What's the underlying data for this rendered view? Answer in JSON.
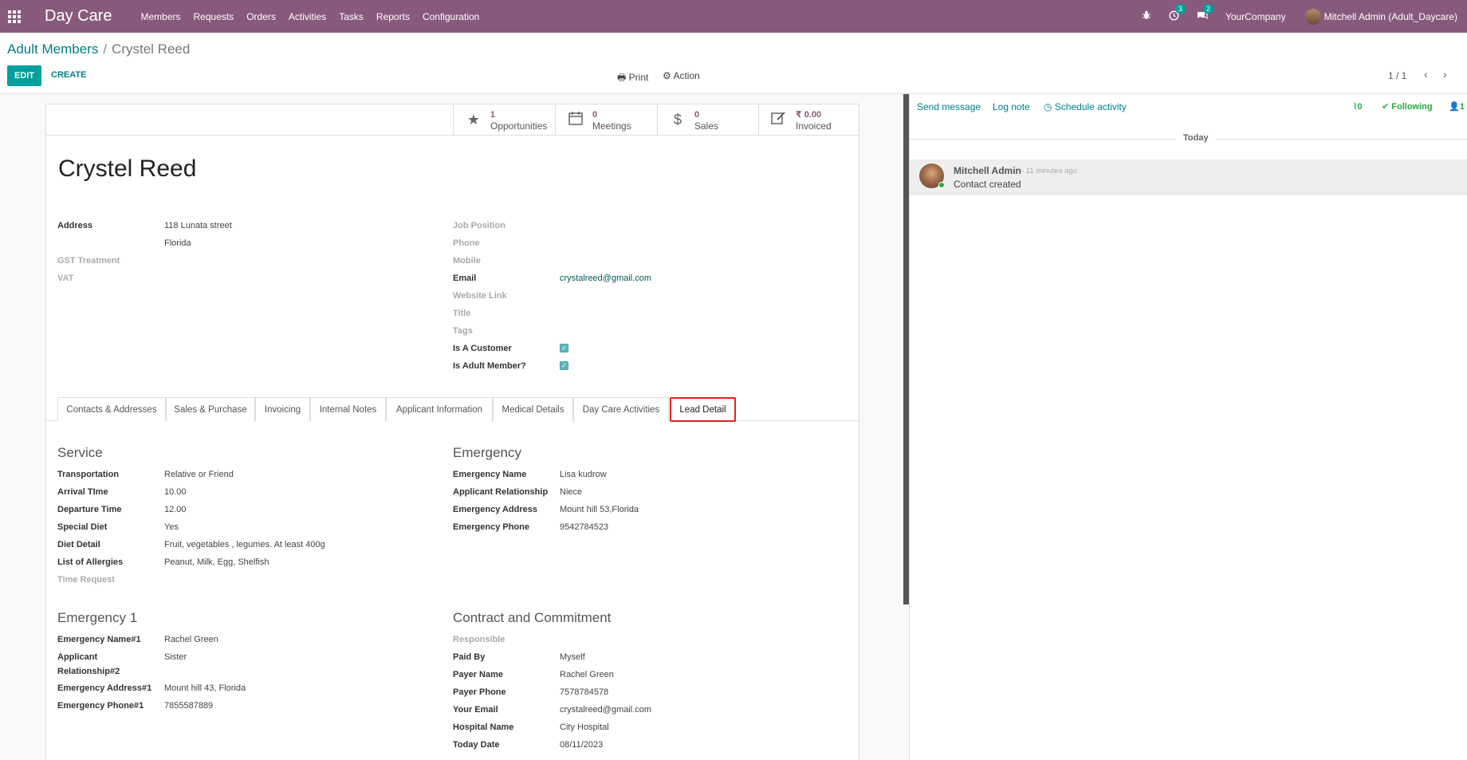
{
  "navbar": {
    "brand": "Day Care",
    "menu": [
      "Members",
      "Requests",
      "Orders",
      "Activities",
      "Tasks",
      "Reports",
      "Configuration"
    ],
    "activity_count": "3",
    "message_count": "2",
    "company": "YourCompany",
    "user": "Mitchell Admin (Adult_Daycare)"
  },
  "control": {
    "breadcrumb_parent": "Adult Members",
    "breadcrumb_sep": "/",
    "breadcrumb_current": "Crystel Reed",
    "edit_label": "EDIT",
    "create_label": "CREATE",
    "print_label": "Print",
    "action_label": "Action",
    "pager": "1 / 1"
  },
  "stats": [
    {
      "value": "1",
      "label": "Opportunities",
      "icon": "star-icon"
    },
    {
      "value": "0",
      "label": "Meetings",
      "icon": "calendar-icon"
    },
    {
      "value": "0",
      "label": "Sales",
      "icon": "dollar-icon"
    },
    {
      "value": "₹ 0.00",
      "label": "Invoiced",
      "icon": "edit-icon"
    }
  ],
  "partner": {
    "name": "Crystel Reed",
    "address_label": "Address",
    "street": "118 Lunata street",
    "state": "Florida",
    "gst_label": "GST Treatment",
    "vat_label": "VAT",
    "job_label": "Job Position",
    "phone_label": "Phone",
    "mobile_label": "Mobile",
    "email_label": "Email",
    "email": "crystalreed@gmail.com",
    "website_label": "Website Link",
    "title_label": "Title",
    "tags_label": "Tags",
    "customer_label": "Is A Customer",
    "adult_label": "Is Adult Member?"
  },
  "tabs": [
    "Contacts & Addresses",
    "Sales & Purchase",
    "Invoicing",
    "Internal Notes",
    "Applicant Information",
    "Medical Details",
    "Day Care Activities",
    "Lead Detail"
  ],
  "service": {
    "title": "Service",
    "rows": [
      {
        "label": "Transportation",
        "value": "Relative or Friend"
      },
      {
        "label": "Arrival TIme",
        "value": "10.00"
      },
      {
        "label": "Departure Time",
        "value": "12.00"
      },
      {
        "label": "Special Diet",
        "value": "Yes"
      },
      {
        "label": "Diet Detail",
        "value": "Fruit, vegetables , legumes. At least 400g"
      },
      {
        "label": "List of Allergies",
        "value": "Peanut, Milk, Egg, Shelfish"
      },
      {
        "label": "Time Request",
        "value": ""
      }
    ]
  },
  "emergency": {
    "title": "Emergency",
    "rows": [
      {
        "label": "Emergency Name",
        "value": "Lisa kudrow"
      },
      {
        "label": "Applicant Relationship",
        "value": "Niece"
      },
      {
        "label": "Emergency Address",
        "value": "Mount hill 53,Florida"
      },
      {
        "label": "Emergency Phone",
        "value": "9542784523"
      }
    ]
  },
  "emergency1": {
    "title": "Emergency 1",
    "rows": [
      {
        "label": "Emergency Name#1",
        "value": "Rachel Green"
      },
      {
        "label": "Applicant",
        "label2": "Relationship#2",
        "value": "Sister"
      },
      {
        "label": "Emergency Address#1",
        "value": "Mount hill 43, Florida"
      },
      {
        "label": "Emergency Phone#1",
        "value": "7855587889"
      }
    ]
  },
  "contract": {
    "title": "Contract and Commitment",
    "rows": [
      {
        "label": "Responsible",
        "value": ""
      },
      {
        "label": "Paid By",
        "value": "Myself"
      },
      {
        "label": "Payer Name",
        "value": "Rachel Green"
      },
      {
        "label": "Payer Phone",
        "value": "7578784578"
      },
      {
        "label": "Your Email",
        "value": "crystalreed@gmail.com"
      },
      {
        "label": "Hospital Name",
        "value": "City Hospital"
      },
      {
        "label": "Today Date",
        "value": "08/11/2023"
      }
    ]
  },
  "chatter": {
    "send_message": "Send message",
    "log_note": "Log note",
    "schedule_activity": "Schedule activity",
    "attachments": "0",
    "following": "Following",
    "followers": "1",
    "today": "Today",
    "author": "Mitchell Admin",
    "time": "- 11 minutes ago",
    "body": "Contact created"
  }
}
